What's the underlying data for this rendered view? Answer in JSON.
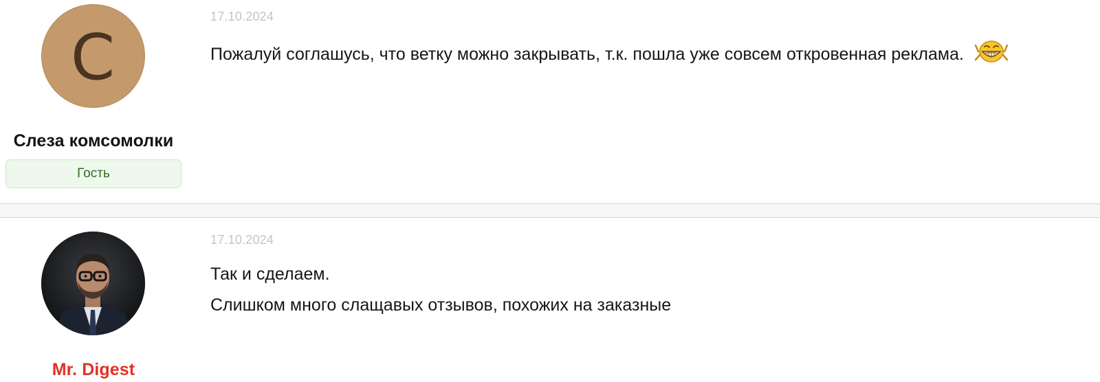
{
  "posts": [
    {
      "date": "17.10.2024",
      "author": {
        "name": "Слеза комсомолки",
        "avatar_letter": "С",
        "role": "Гость"
      },
      "text": "Пожалуй соглашусь, что ветку можно закрывать, т.к. пошла уже совсем откровенная реклама.",
      "emoticon": "laughing-smiley-icon"
    },
    {
      "date": "17.10.2024",
      "author": {
        "name": "Mr. Digest",
        "name_color": "#e03222"
      },
      "paragraphs": [
        "Так и сделаем.",
        "Слишком много слащавых отзывов, похожих на заказные"
      ]
    }
  ],
  "colors": {
    "avatar_bg": "#c49a6c",
    "role_badge_bg": "#eef8ec",
    "role_badge_text": "#2f6a22",
    "date": "#c4c4c4"
  }
}
